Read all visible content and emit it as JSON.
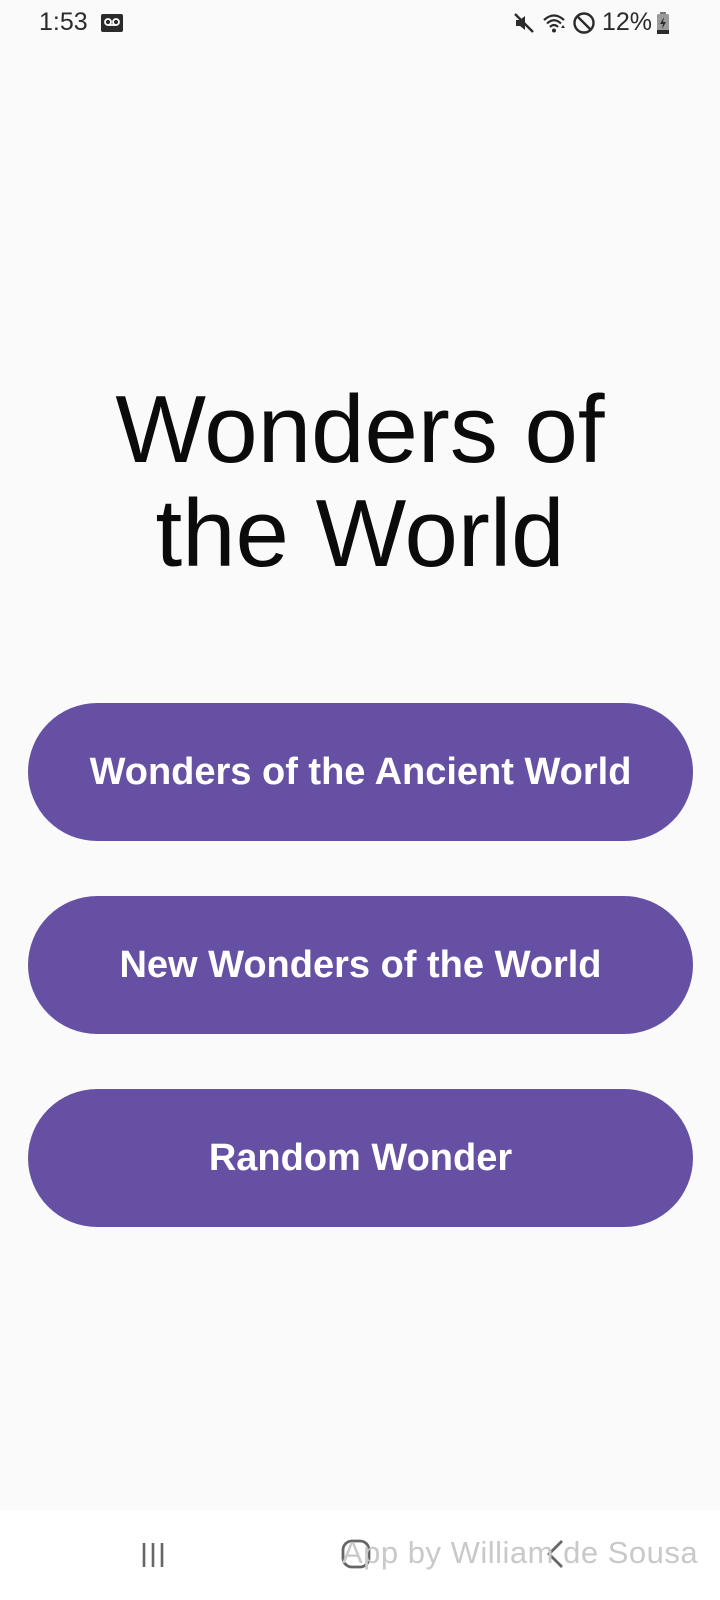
{
  "status_bar": {
    "time": "1:53",
    "battery": "12%",
    "icons": [
      "voicemail-icon",
      "mute-icon",
      "wifi-icon",
      "do-not-disturb-icon",
      "battery-charging-icon"
    ]
  },
  "main": {
    "title": "Wonders of the World",
    "buttons": [
      {
        "label": "Wonders of the Ancient World"
      },
      {
        "label": "New Wonders of the World"
      },
      {
        "label": "Random Wonder"
      }
    ]
  },
  "footer": {
    "credit": "App by William de Sousa"
  },
  "nav_bar": {
    "icons": [
      "recent-apps-icon",
      "home-icon",
      "back-icon"
    ]
  },
  "colors": {
    "accent": "#6650a4",
    "background": "#fafafa",
    "button_text": "#ffffff"
  }
}
